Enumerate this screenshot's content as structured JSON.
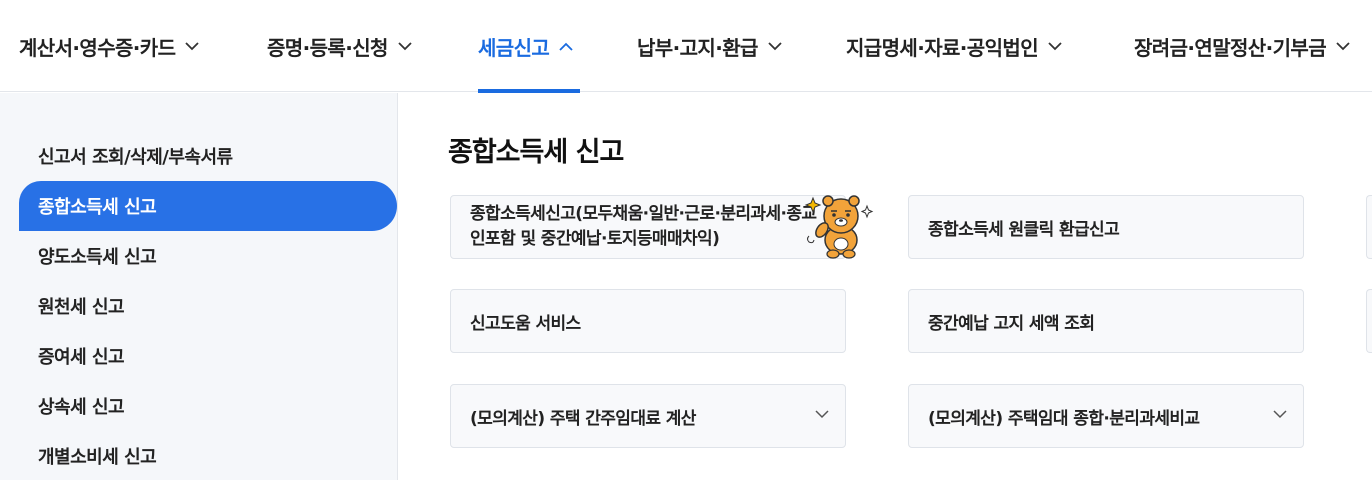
{
  "topnav": {
    "items": [
      {
        "label": "계산서·영수증·카드"
      },
      {
        "label": "증명·등록·신청"
      },
      {
        "label": "세금신고"
      },
      {
        "label": "납부·고지·환급"
      },
      {
        "label": "지급명세·자료·공익법인"
      },
      {
        "label": "장려금·연말정산·기부금"
      }
    ],
    "active_index": 2,
    "accent_color": "#1a6be0"
  },
  "sidebar": {
    "items": [
      {
        "label": "신고서 조회/삭제/부속서류"
      },
      {
        "label": "종합소득세 신고"
      },
      {
        "label": "양도소득세 신고"
      },
      {
        "label": "원천세 신고"
      },
      {
        "label": "증여세 신고"
      },
      {
        "label": "상속세 신고"
      },
      {
        "label": "개별소비세 신고"
      }
    ],
    "active_index": 1,
    "active_color": "#2871e6"
  },
  "main": {
    "title": "종합소득세 신고",
    "cards": [
      {
        "label": "종합소득세신고(모두채움·일반·근로·분리과세·종교인포함 및 중간예납·토지등매매차익)",
        "icon": "mascot-character-icon"
      },
      {
        "label": "종합소득세 원클릭 환급신고"
      },
      {
        "label": "신고도움 서비스"
      },
      {
        "label": "중간예납 고지 세액 조회"
      },
      {
        "label": "(모의계산) 주택 간주임대료 계산",
        "icon": "chevron-down-icon"
      },
      {
        "label": "(모의계산) 주택임대 종합·분리과세비교",
        "icon": "chevron-down-icon"
      }
    ]
  }
}
